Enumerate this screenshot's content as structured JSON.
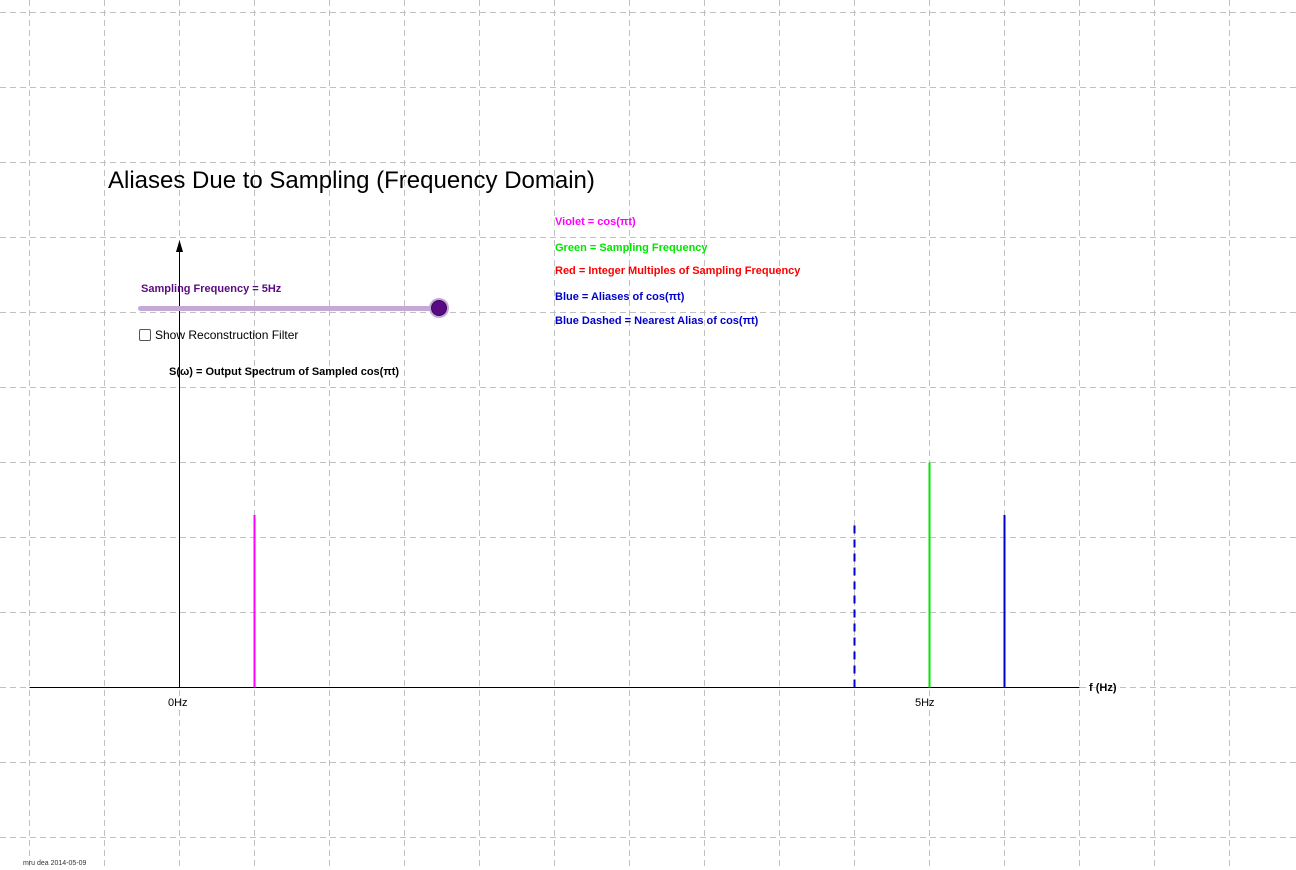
{
  "title": "Aliases Due to Sampling (Frequency Domain)",
  "legend": [
    {
      "text": "Violet = cos(πt)",
      "color": "#ff00ff"
    },
    {
      "text": "Green = Sampling Frequency",
      "color": "#00e600"
    },
    {
      "text": "Red = Integer Multiples of Sampling Frequency",
      "color": "#ff0000"
    },
    {
      "text": "Blue = Aliases of cos(πt)",
      "color": "#0000cc"
    },
    {
      "text": "Blue Dashed = Nearest Alias of cos(πt)",
      "color": "#0000cc"
    }
  ],
  "slider": {
    "label": "Sampling Frequency = 5Hz",
    "label_color": "#5a0a82",
    "value": 5,
    "min": 0,
    "max": 5
  },
  "checkbox": {
    "label": "Show Reconstruction Filter",
    "checked": false
  },
  "chart_data": {
    "type": "stem",
    "y_axis_label": "S(ω) = Output Spectrum of Sampled cos(πt)",
    "x_axis_label": "f (Hz)",
    "x_ticks": [
      {
        "value": 0,
        "label": "0Hz"
      },
      {
        "value": 5,
        "label": "5Hz"
      }
    ],
    "x_range": [
      -1,
      6
    ],
    "y_range": [
      -1.2,
      4.5
    ],
    "grid": true,
    "stems": [
      {
        "name": "cos(πt)",
        "x": 0.5,
        "y": 1.15,
        "color": "#ff00ff",
        "style": "solid"
      },
      {
        "name": "Sampling Frequency",
        "x": 5,
        "y": 1.5,
        "color": "#00e600",
        "style": "solid"
      },
      {
        "name": "Nearest Alias",
        "x": 4.5,
        "y": 1.1,
        "color": "#0000cc",
        "style": "dashed"
      },
      {
        "name": "Alias",
        "x": 5.5,
        "y": 1.15,
        "color": "#0000cc",
        "style": "solid"
      }
    ]
  },
  "footer": "mru dea 2014-05-09"
}
